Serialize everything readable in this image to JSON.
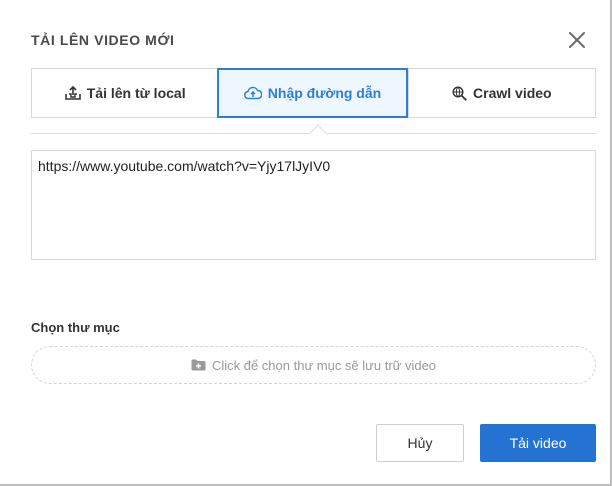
{
  "dialog": {
    "title": "TẢI LÊN VIDEO MỚI",
    "close_icon": "close-icon"
  },
  "tabs": [
    {
      "label": "Tải lên từ local",
      "icon": "upload-tray-icon",
      "active": false
    },
    {
      "label": "Nhập đường dẫn",
      "icon": "cloud-upload-icon",
      "active": true
    },
    {
      "label": "Crawl video",
      "icon": "globe-search-icon",
      "active": false
    }
  ],
  "url_input": {
    "value": "https://www.youtube.com/watch?v=Yjy17lJyIV0"
  },
  "folder": {
    "label": "Chọn thư mục",
    "picker_text": "Click để chọn thư mục sẽ lưu trữ video",
    "icon": "folder-plus-icon"
  },
  "footer": {
    "cancel_label": "Hủy",
    "upload_label": "Tải video"
  },
  "colors": {
    "accent": "#2d7fd3",
    "primary_button": "#2473d2",
    "active_tab_bg": "#eef6ff"
  }
}
